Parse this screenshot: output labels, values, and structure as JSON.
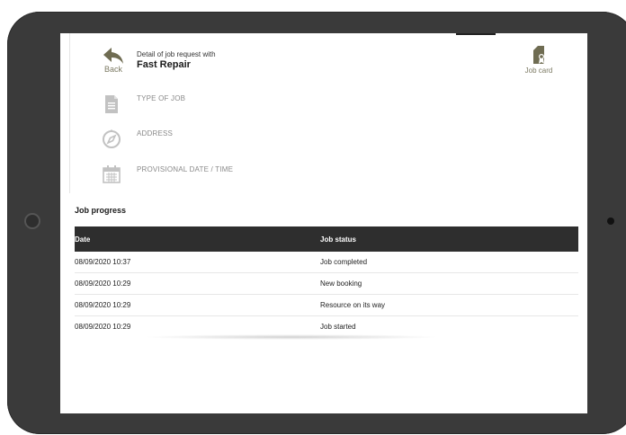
{
  "header": {
    "back_label": "Back",
    "subtitle": "Detail of job request with",
    "title": "Fast Repair",
    "jobcard_label": "Job card"
  },
  "info": {
    "type_label": "TYPE OF JOB",
    "address_label": "ADDRESS",
    "date_label": "PROVISIONAL DATE / TIME"
  },
  "progress": {
    "title": "Job progress",
    "columns": [
      "Date",
      "Job status"
    ],
    "rows": [
      {
        "date": "08/09/2020 10:37",
        "status": "Job completed"
      },
      {
        "date": "08/09/2020 10:29",
        "status": "New booking"
      },
      {
        "date": "08/09/2020 10:29",
        "status": "Resource on its way"
      },
      {
        "date": "08/09/2020 10:29",
        "status": "Job started"
      }
    ]
  },
  "icons": {
    "back": "back-arrow-icon",
    "jobcard": "job-card-icon",
    "type": "document-icon",
    "address": "compass-icon",
    "date": "calendar-icon"
  },
  "colors": {
    "accent": "#7c7a63",
    "icon_gray": "#b9b9b9",
    "table_header": "#2e2e2e",
    "device": "#3a3a3a"
  }
}
